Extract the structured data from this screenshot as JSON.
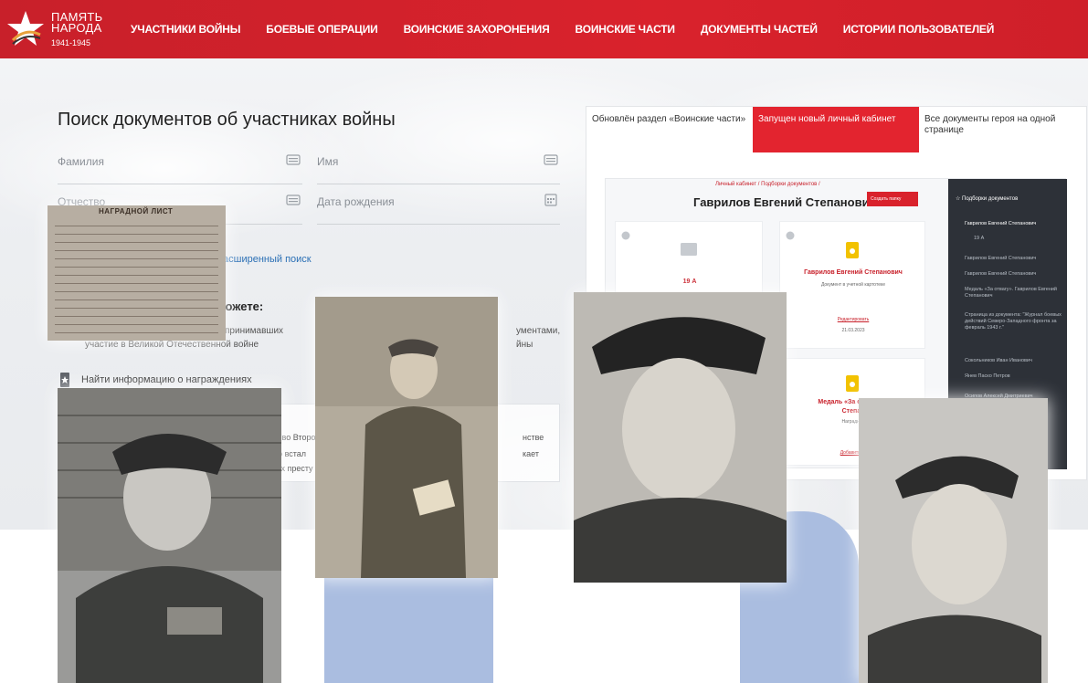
{
  "header": {
    "logo_line1": "ПАМЯТЬ",
    "logo_line2": "НАРОДА",
    "logo_years": "1941-1945",
    "nav": [
      "УЧАСТНИКИ ВОЙНЫ",
      "БОЕВЫЕ ОПЕРАЦИИ",
      "ВОИНСКИЕ ЗАХОРОНЕНИЯ",
      "ВОИНСКИЕ ЧАСТИ",
      "ДОКУМЕНТЫ ЧАСТЕЙ",
      "ИСТОРИИ ПОЛЬЗОВАТЕЛЕЙ"
    ]
  },
  "search": {
    "title": "Поиск документов об участниках войны",
    "surname_label": "Фамилия",
    "name_label": "Имя",
    "patronymic_label": "Отчество",
    "birthdate_label": "Дата рождения",
    "advanced_link": "асширенный поиск",
    "can_title": "можете:",
    "snippet_left_1": "принимавших",
    "snippet_left_2": "участие в Великой Отечественной войне",
    "snippet_right_1": "ументами,",
    "snippet_right_2": "йны",
    "award_text": "Найти информацию о награждениях",
    "box_line1_a": "ие во Второ",
    "box_line1_b": "нстве",
    "box_line2_a": "кто встал",
    "box_line2_b": "кает",
    "box_line3": "ных престу"
  },
  "news": {
    "tabs": [
      "Обновлён раздел «Воинские части»",
      "Запущен новый личный кабинет",
      "Все документы героя на одной странице"
    ],
    "preview": {
      "breadcrumb": "Личный кабинет / Подборки документов /",
      "person": "Гаврилов Евгений Степанович",
      "create_button": "Создать папку",
      "folder_name": "19 А",
      "card1_title": "Гаврилов Евгений Степанович",
      "card1_sub": "Документ в учетной картотеке",
      "card1_edit": "Редактировать",
      "card1_date": "21.03.2023",
      "card2_title": "Медаль «За отвагу». Г",
      "card2_title2": "Степан",
      "card2_sub": "Наградной",
      "card2_add": "Добавить ко",
      "side_title": "Подборки документов",
      "side_items": [
        "Гаврилов Евгений Степанович",
        "19 А",
        "Гаврилов Евгений Степанович",
        "Гаврилов Евгений Степанович",
        "Медаль «За отвагу». Гаврилов Евгений Степанович",
        "Страница из документа: \"Журнал боевых действий Северо-Западного фронта за февраль 1943 г.\"",
        "Сокольников Иван Иванович",
        "Янев Паско Петров",
        "Осипов Алексей Дмитриевич"
      ]
    }
  },
  "document": {
    "title": "НАГРАДНОЙ ЛИСТ"
  },
  "colors": {
    "brand_red": "#d9222c",
    "accent_blue": "#aabde0",
    "link_blue": "#2a6fb5"
  }
}
